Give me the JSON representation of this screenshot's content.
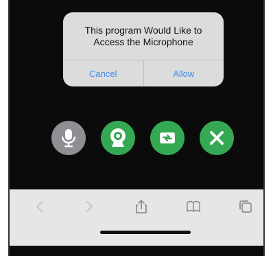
{
  "dialog": {
    "title": "This program Would Like to\nAccess the Microphone",
    "cancel_label": "Cancel",
    "allow_label": "Allow"
  },
  "controls": [
    {
      "name": "microphone",
      "icon": "microphone-icon",
      "color": "#8e8e93"
    },
    {
      "name": "camera",
      "icon": "webcam-icon",
      "color": "#34a853"
    },
    {
      "name": "switch",
      "icon": "switch-camera-icon",
      "color": "#34a853"
    },
    {
      "name": "end",
      "icon": "close-icon",
      "color": "#34a853"
    }
  ],
  "toolbar": {
    "icons": [
      "back-icon",
      "forward-icon",
      "share-icon",
      "bookmarks-icon",
      "tabs-icon"
    ]
  },
  "colors": {
    "background": "#0b0b0b",
    "dialog": "#dcdcdc",
    "action_text": "#3f8cf0",
    "active_green": "#34a853",
    "inactive_gray": "#8e8e93",
    "toolbar": "#e6e6e6"
  }
}
